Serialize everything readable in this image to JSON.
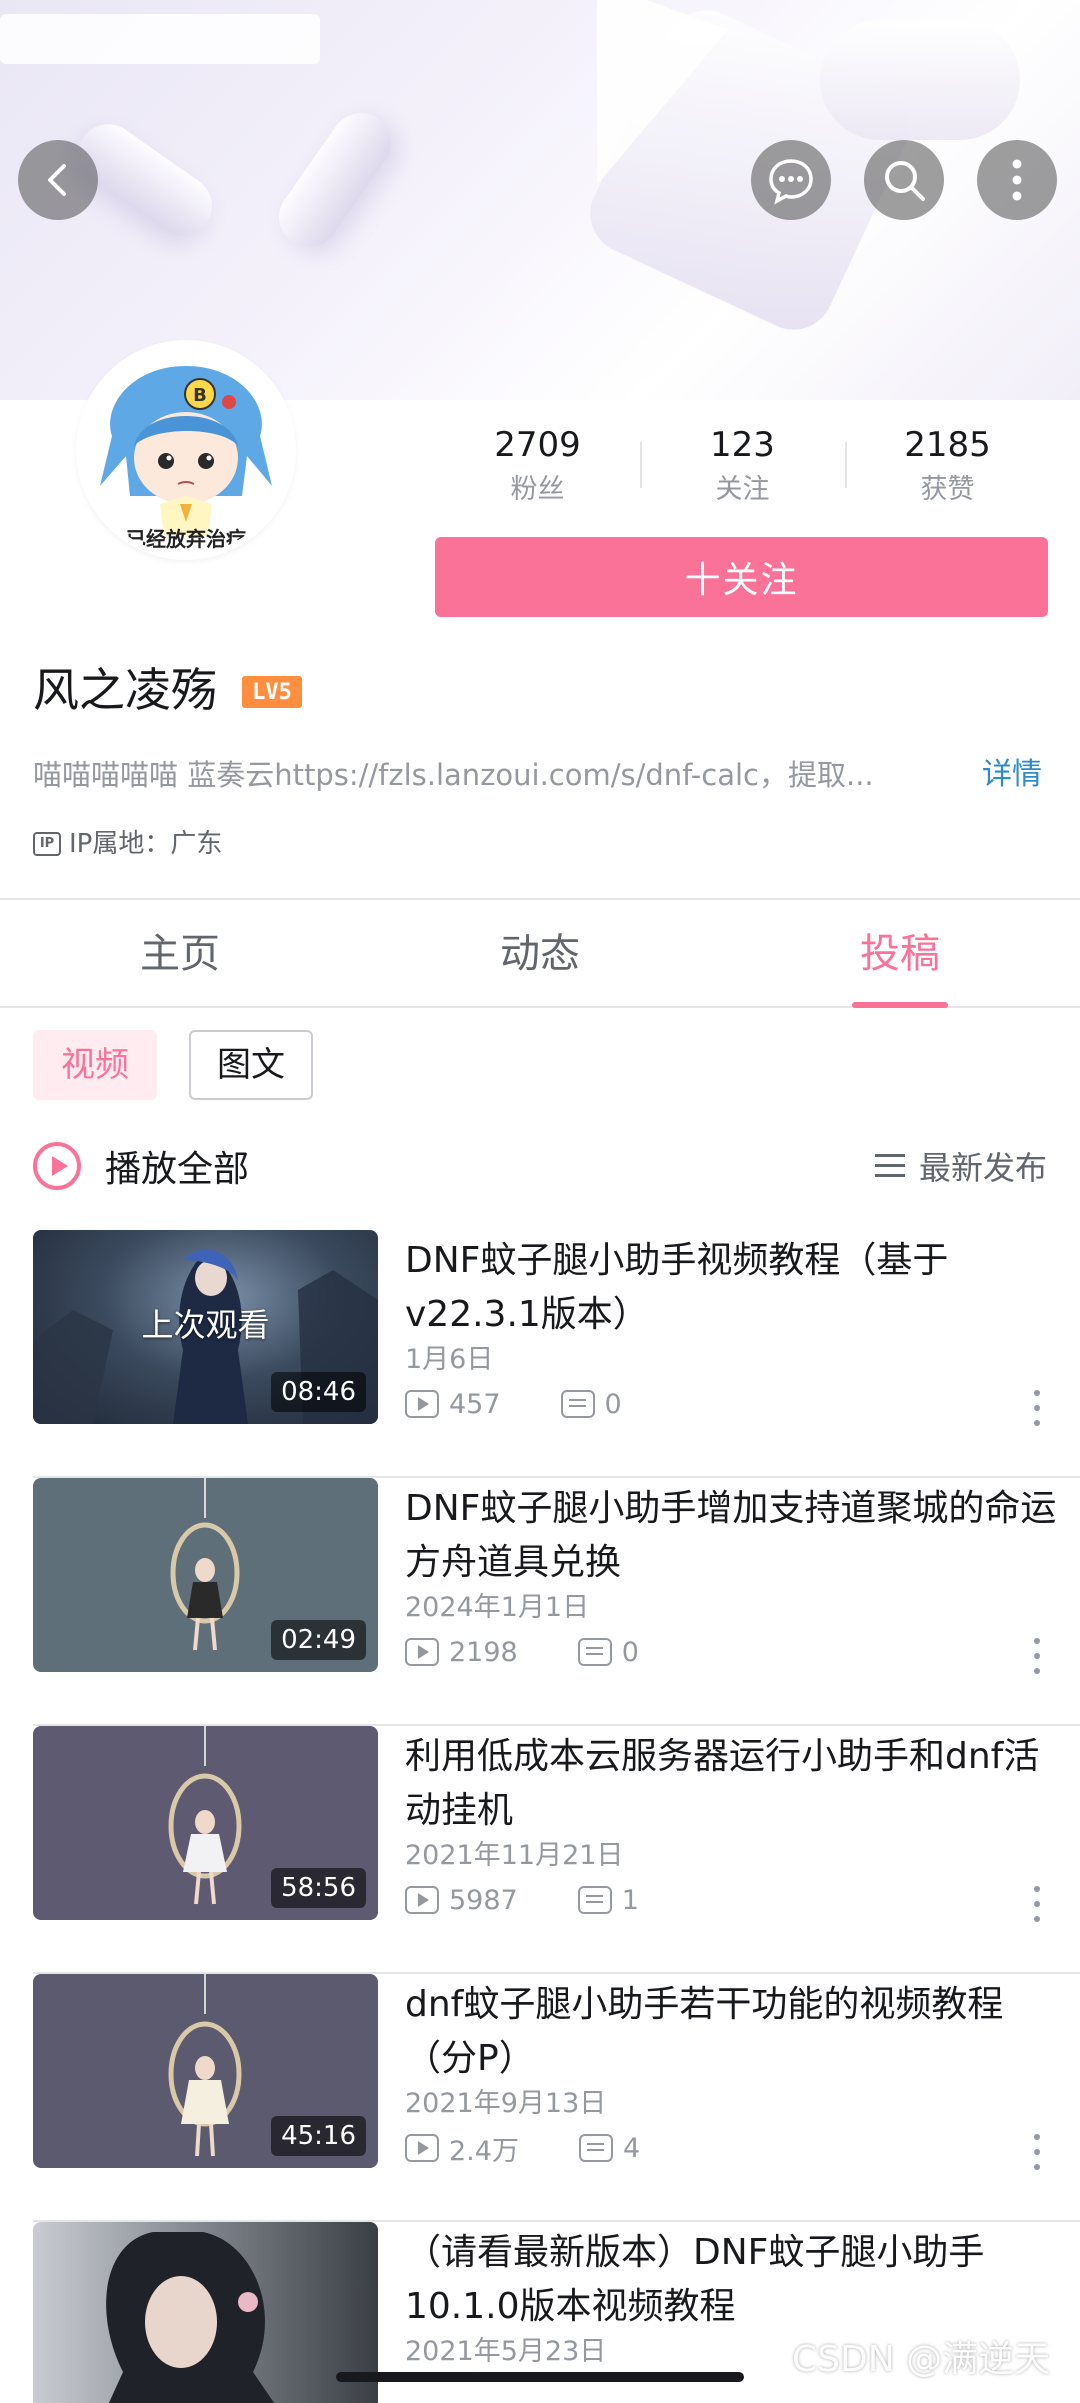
{
  "header": {
    "back_icon": "back-arrow-icon",
    "message_icon": "chat-bubble-icon",
    "search_icon": "search-icon",
    "more_icon": "more-vertical-icon"
  },
  "profile": {
    "avatar_text": "已经放弃治疗",
    "stats": [
      {
        "value": "2709",
        "label": "粉丝"
      },
      {
        "value": "123",
        "label": "关注"
      },
      {
        "value": "2185",
        "label": "获赞"
      }
    ],
    "follow_label": "十关注",
    "username": "风之凌殇",
    "level": "LV5",
    "bio": "喵喵喵喵喵 蓝奏云https://fzls.lanzoui.com/s/dnf-calc，提取...",
    "bio_detail": "详情",
    "ip_badge": "IP",
    "ip_location": "IP属地：广东"
  },
  "tabs": [
    {
      "label": "主页"
    },
    {
      "label": "动态"
    },
    {
      "label": "投稿"
    }
  ],
  "filters": {
    "video": "视频",
    "article": "图文"
  },
  "play_all": "播放全部",
  "sort_label": "最新发布",
  "videos": [
    {
      "title": "DNF蚊子腿小助手视频教程（基于v22.3.1版本）",
      "date": "1月6日",
      "plays": "457",
      "comments": "0",
      "duration": "08:46",
      "overlay": "上次观看"
    },
    {
      "title": "DNF蚊子腿小助手增加支持道聚城的命运方舟道具兑换",
      "date": "2024年1月1日",
      "plays": "2198",
      "comments": "0",
      "duration": "02:49"
    },
    {
      "title": "利用低成本云服务器运行小助手和dnf活动挂机",
      "date": "2021年11月21日",
      "plays": "5987",
      "comments": "1",
      "duration": "58:56"
    },
    {
      "title": "dnf蚊子腿小助手若干功能的视频教程（分P）",
      "date": "2021年9月13日",
      "plays": "2.4万",
      "comments": "4",
      "duration": "45:16"
    },
    {
      "title": "（请看最新版本）DNF蚊子腿小助手10.1.0版本视频教程",
      "date": "2021年5月23日"
    }
  ],
  "watermark": "CSDN @满逆天",
  "colors": {
    "accent": "#fb7299",
    "link": "#2e8bc9",
    "level": "#ff8f3f"
  }
}
